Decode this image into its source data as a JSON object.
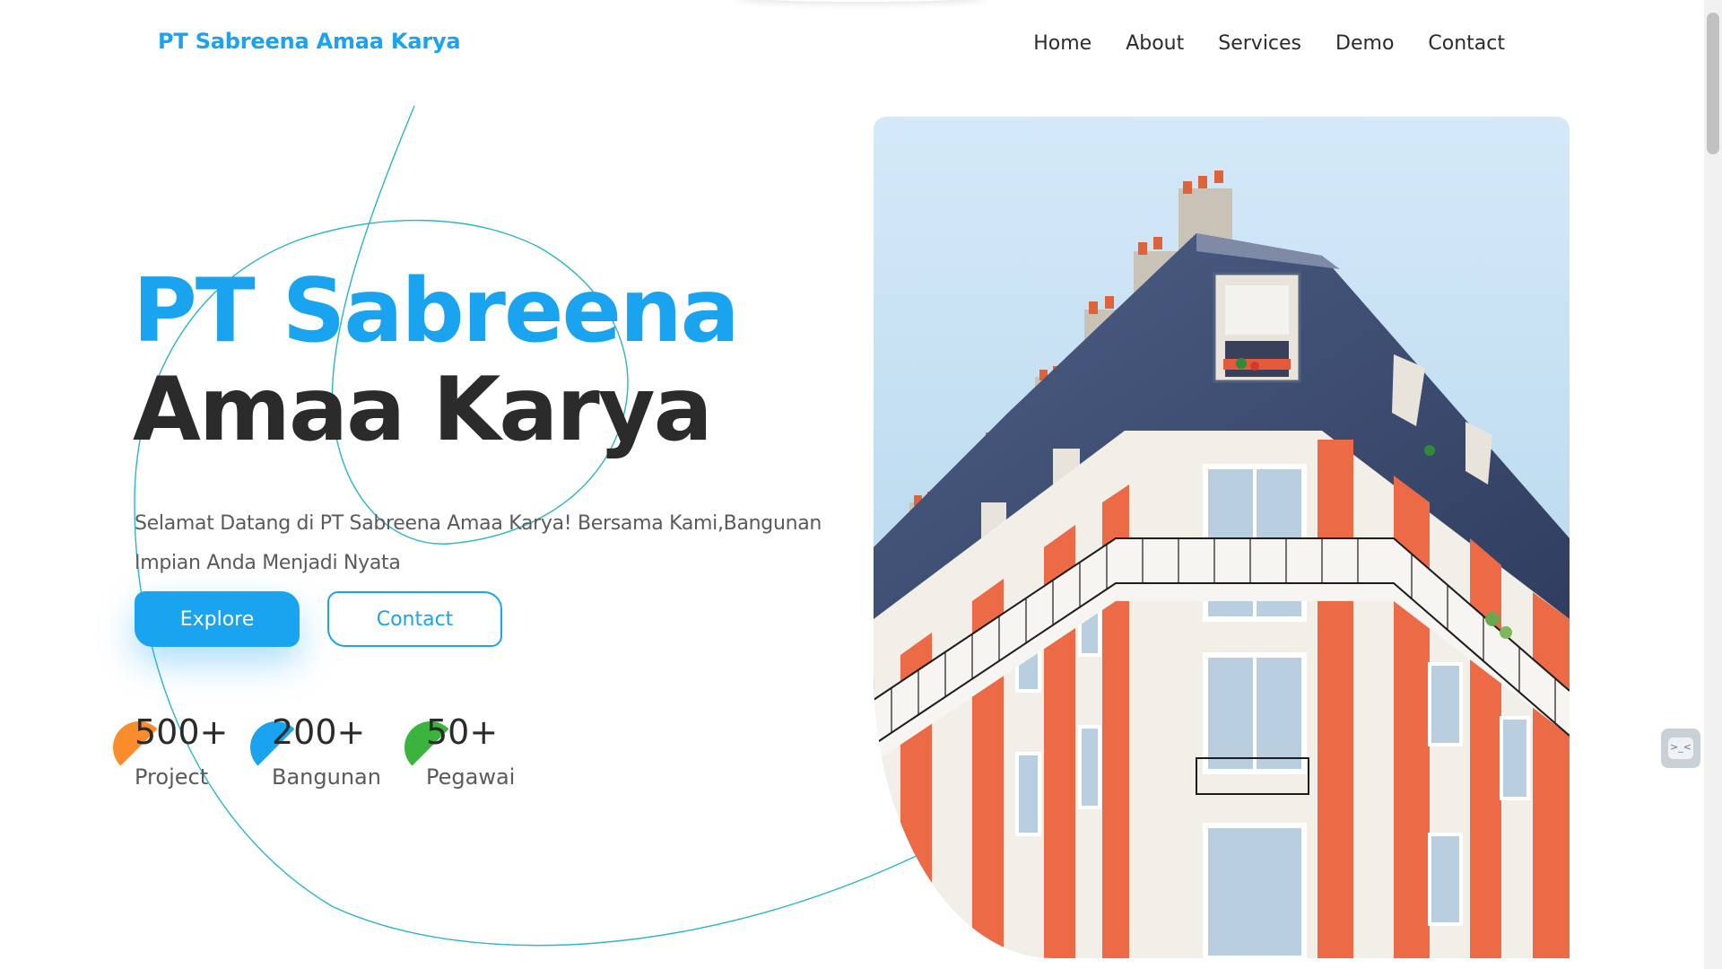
{
  "header": {
    "logo": "PT Sabreena Amaa Karya",
    "nav": [
      "Home",
      "About",
      "Services",
      "Demo",
      "Contact"
    ]
  },
  "hero": {
    "title_line1": "PT Sabreena",
    "title_line2": "Amaa Karya",
    "subtitle": "Selamat Datang di PT Sabreena Amaa Karya! Bersama Kami,Bangunan Impian Anda Menjadi Nyata",
    "explore_label": "Explore",
    "contact_label": "Contact"
  },
  "stats": [
    {
      "value": "500+",
      "label": "Project",
      "color": "#fa8c2e"
    },
    {
      "value": "200+",
      "label": "Bangunan",
      "color": "#1aa3ef"
    },
    {
      "value": "50+",
      "label": "Pegawai",
      "color": "#3ab43c"
    }
  ],
  "colors": {
    "accent": "#1aa3ef",
    "text": "#2b2b2b"
  },
  "icons": {
    "side_widget": "chat-icon"
  }
}
